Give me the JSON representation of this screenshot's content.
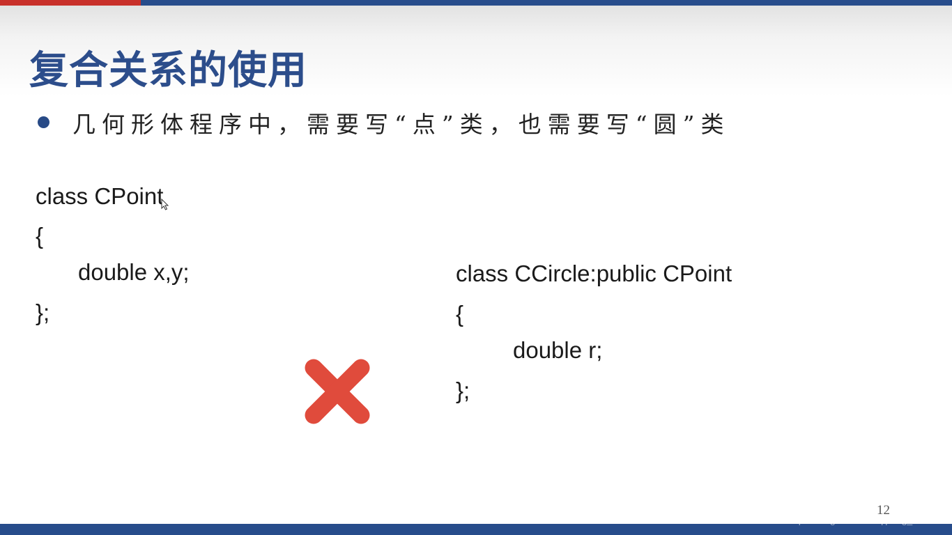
{
  "slide": {
    "title": "复合关系的使用",
    "bullet": "几何形体程序中，需要写“点”类，也需要写“圆”类",
    "page_number": "12",
    "watermark": "https://blog.csdn.net/qipeng_master"
  },
  "code_left": {
    "lines": [
      "class CPoint",
      "{",
      "double x,y;",
      "};"
    ]
  },
  "code_right": {
    "lines": [
      "class CCircle:public CPoint",
      "{",
      "double r;",
      "};"
    ]
  },
  "marks": {
    "cross_icon": "red-x-cross",
    "cross_color": "#e04b3c"
  },
  "colors": {
    "accent_blue": "#274c8b",
    "accent_red": "#c8302a"
  }
}
